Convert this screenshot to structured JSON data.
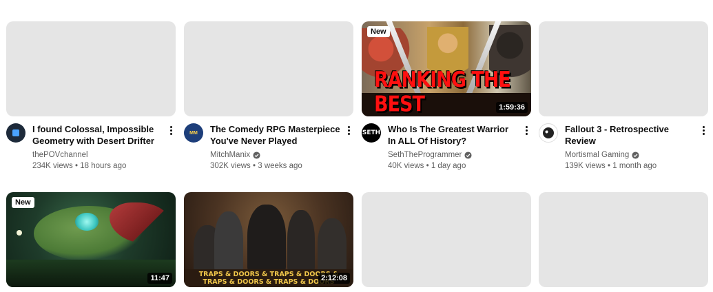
{
  "videos": [
    {
      "title": "I found Colossal, Impossible Geometry with Desert Drifter",
      "channel": "thePOVchannel",
      "verified": false,
      "stats": "234K views • 18 hours ago",
      "thumbnail": "empty",
      "badge": "",
      "duration": "",
      "avatar_icon": "pov-channel-avatar"
    },
    {
      "title": "The Comedy RPG Masterpiece You've Never Played",
      "channel": "MitchManix",
      "verified": true,
      "stats": "302K views • 3 weeks ago",
      "thumbnail": "empty",
      "badge": "",
      "duration": "",
      "avatar_icon": "mitchmanix-avatar"
    },
    {
      "title": "Who Is The Greatest Warrior In ALL Of History?",
      "channel": "SethTheProgrammer",
      "verified": true,
      "stats": "40K views • 1 day ago",
      "thumbnail": "ranking",
      "badge": "New",
      "duration": "1:59:36",
      "thumb_text": "RANKING THE BEST",
      "avatar_text": "SETH",
      "avatar_icon": "seth-avatar"
    },
    {
      "title": "Fallout 3 - Retrospective Review",
      "channel": "Mortismal Gaming",
      "verified": true,
      "stats": "139K views • 1 month ago",
      "thumbnail": "empty",
      "badge": "",
      "duration": "",
      "avatar_icon": "skull-avatar"
    },
    {
      "thumbnail": "frog",
      "badge": "New",
      "duration": "11:47"
    },
    {
      "thumbnail": "traps",
      "badge": "",
      "duration": "2:12:08",
      "thumb_text": "TRAPS & DOORS & TRAPS & DOORS & TRAPS & DOORS & TRAPS & DOORS"
    },
    {
      "thumbnail": "empty"
    },
    {
      "thumbnail": "empty"
    }
  ],
  "colors": {
    "placeholder": "#e5e5e5",
    "title": "#0f0f0f",
    "meta": "#606060",
    "ranking_text": "#ff1010",
    "traps_text": "#f0c64a"
  }
}
